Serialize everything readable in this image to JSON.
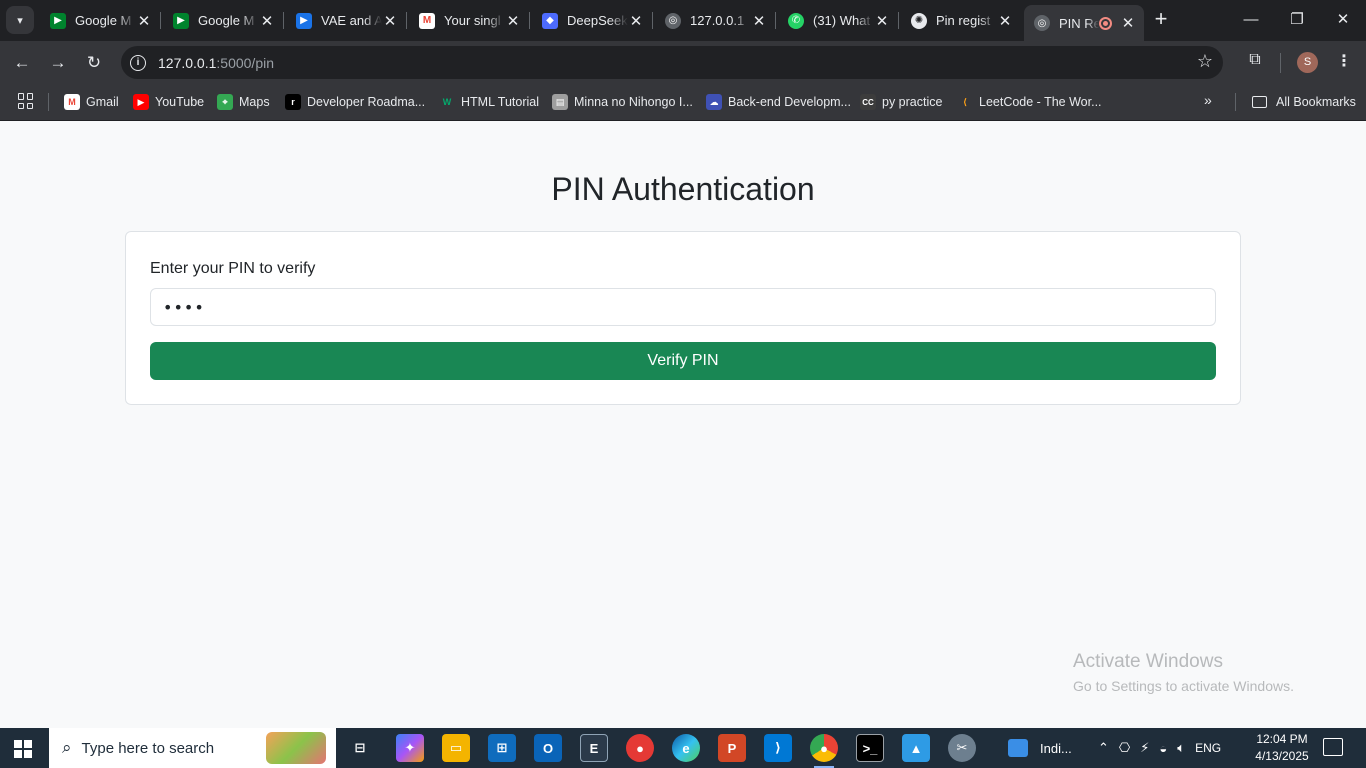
{
  "browser": {
    "tabs": [
      {
        "title": "Google M",
        "icon": "google-meet-icon",
        "color": "#00832d"
      },
      {
        "title": "Google M",
        "icon": "google-meet-icon",
        "color": "#00832d"
      },
      {
        "title": "VAE and A",
        "icon": "video-icon",
        "color": "#1a73e8"
      },
      {
        "title": "Your singl",
        "icon": "gmail-icon",
        "color": "#ea4335"
      },
      {
        "title": "DeepSeek",
        "icon": "deepseek-icon",
        "color": "#4d6bfe"
      },
      {
        "title": "127.0.0.1",
        "icon": "globe-icon",
        "color": "#9aa0a6"
      },
      {
        "title": "(31) What",
        "icon": "whatsapp-icon",
        "color": "#25d366"
      },
      {
        "title": "Pin regist",
        "icon": "openai-icon",
        "color": "#e8eaed"
      },
      {
        "title": "PIN Re",
        "icon": "globe-icon",
        "color": "#9aa0a6"
      }
    ],
    "address": {
      "host": "127.0.0.1",
      "path": ":5000/pin"
    },
    "profile_initial": "S",
    "bookmarks": [
      {
        "label": "Gmail",
        "icon": "gmail-icon",
        "color": "#ea4335"
      },
      {
        "label": "YouTube",
        "icon": "youtube-icon",
        "color": "#ff0000"
      },
      {
        "label": "Maps",
        "icon": "maps-icon",
        "color": "#34a853"
      },
      {
        "label": "Developer Roadma...",
        "icon": "roadmap-icon",
        "color": "#000000"
      },
      {
        "label": "HTML Tutorial",
        "icon": "w3schools-icon",
        "color": "#04aa6d"
      },
      {
        "label": "Minna no Nihongo I...",
        "icon": "book-icon",
        "color": "#9e9e9e"
      },
      {
        "label": "Back-end Developm...",
        "icon": "course-icon",
        "color": "#3f51b5"
      },
      {
        "label": "py practice",
        "icon": "cc-icon",
        "color": "#3c3c3c"
      },
      {
        "label": "LeetCode - The Wor...",
        "icon": "leetcode-icon",
        "color": "#ffa116"
      }
    ],
    "all_bookmarks": "All Bookmarks"
  },
  "page": {
    "title": "PIN Authentication",
    "label": "Enter your PIN to verify",
    "pin_value": "••••",
    "button": "Verify PIN",
    "button_color": "#198754"
  },
  "watermark": {
    "line1": "Activate Windows",
    "line2": "Go to Settings to activate Windows."
  },
  "taskbar": {
    "search_placeholder": "Type here to search",
    "weather": "Indi...",
    "language": "ENG",
    "time": "12:04 PM",
    "date": "4/13/2025"
  }
}
